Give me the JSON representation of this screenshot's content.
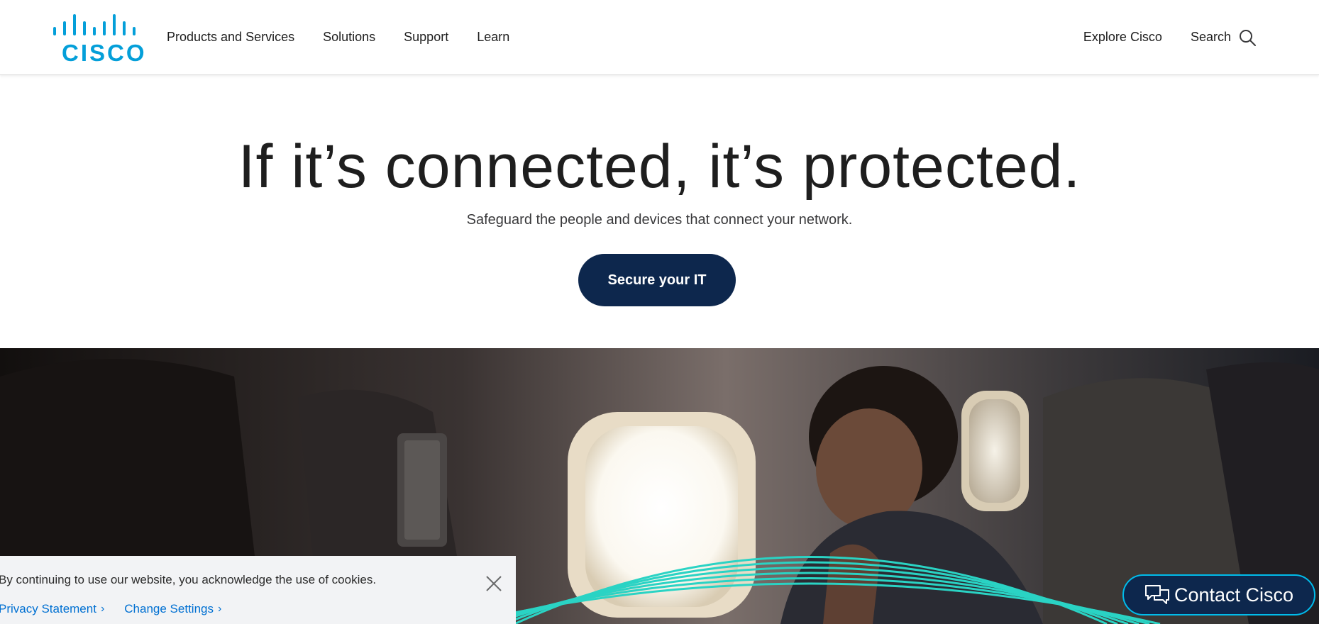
{
  "brand": {
    "wordmark": "CISCO",
    "color": "#049fd9"
  },
  "nav": {
    "left": [
      {
        "label": "Products and Services"
      },
      {
        "label": "Solutions"
      },
      {
        "label": "Support"
      },
      {
        "label": "Learn"
      }
    ],
    "explore_label": "Explore Cisco",
    "search_label": "Search",
    "search_icon": "search-icon"
  },
  "hero": {
    "title": "If it’s connected, it’s protected.",
    "subtitle": "Safeguard the people and devices that connect your network.",
    "cta_label": "Secure your IT",
    "cta_color": "#0d274d"
  },
  "cookie": {
    "message": "By continuing to use our website, you acknowledge the use of cookies.",
    "privacy_label": "Privacy Statement",
    "settings_label": "Change Settings",
    "close_icon": "close-icon"
  },
  "contact": {
    "label": "Contact Cisco",
    "icon": "chat-icon",
    "border_color": "#00bceb"
  }
}
